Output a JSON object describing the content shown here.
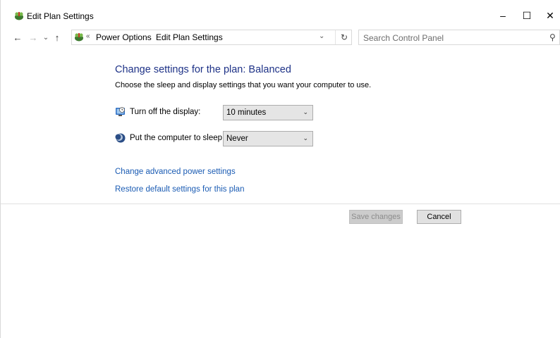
{
  "window": {
    "title": "Edit Plan Settings",
    "controls": {
      "minimize": "–",
      "maximize": "☐",
      "close": "✕"
    }
  },
  "nav": {
    "back": "←",
    "forward": "→",
    "recent": "⌄",
    "up": "↑",
    "address": {
      "overflow": "«",
      "crumbs": [
        "Power Options",
        "Edit Plan Settings"
      ],
      "separator": "›",
      "dropdown": "⌄",
      "refresh": "↻"
    },
    "search": {
      "placeholder": "Search Control Panel",
      "value": "",
      "icon": "⚲"
    }
  },
  "main": {
    "heading": "Change settings for the plan: Balanced",
    "subtext": "Choose the sleep and display settings that you want your computer to use.",
    "settings": [
      {
        "label": "Turn off the display:",
        "value": "10 minutes",
        "icon": "display-icon"
      },
      {
        "label": "Put the computer to sleep:",
        "value": "Never",
        "icon": "moon-icon"
      }
    ],
    "links": {
      "advanced": "Change advanced power settings",
      "restore": "Restore default settings for this plan"
    },
    "buttons": {
      "save": "Save changes",
      "cancel": "Cancel"
    }
  },
  "colors": {
    "heading": "#1e3287",
    "link": "#1a5bb3",
    "disabled_text": "#8c8c8c"
  }
}
